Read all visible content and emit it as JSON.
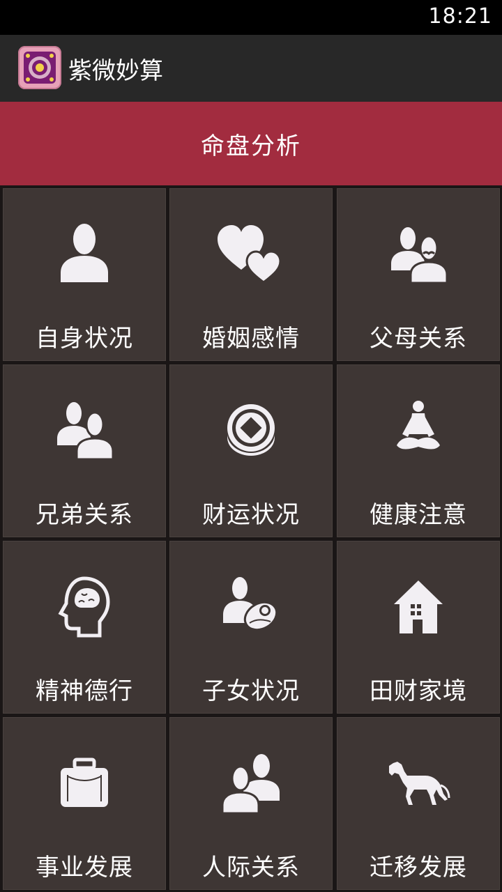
{
  "status_bar": {
    "time": "18:21"
  },
  "app_bar": {
    "title": "紫微妙算",
    "icon": "purple-bagua-app-icon"
  },
  "section": {
    "title": "命盘分析"
  },
  "tiles": [
    {
      "label": "自身状况",
      "icon": "person-icon"
    },
    {
      "label": "婚姻感情",
      "icon": "hearts-icon"
    },
    {
      "label": "父母关系",
      "icon": "parents-icon"
    },
    {
      "label": "兄弟关系",
      "icon": "siblings-icon"
    },
    {
      "label": "财运状况",
      "icon": "coin-icon"
    },
    {
      "label": "健康注意",
      "icon": "meditation-icon"
    },
    {
      "label": "精神德行",
      "icon": "brain-head-icon"
    },
    {
      "label": "子女状况",
      "icon": "parent-baby-icon"
    },
    {
      "label": "田财家境",
      "icon": "house-icon"
    },
    {
      "label": "事业发展",
      "icon": "briefcase-icon"
    },
    {
      "label": "人际关系",
      "icon": "people-icon"
    },
    {
      "label": "迁移发展",
      "icon": "horse-icon"
    }
  ],
  "colors": {
    "status_bar": "#000000",
    "action_bar": "#282828",
    "banner": "#a22c3f",
    "tile": "#3e3634",
    "icon_fill": "#f2eff3"
  }
}
